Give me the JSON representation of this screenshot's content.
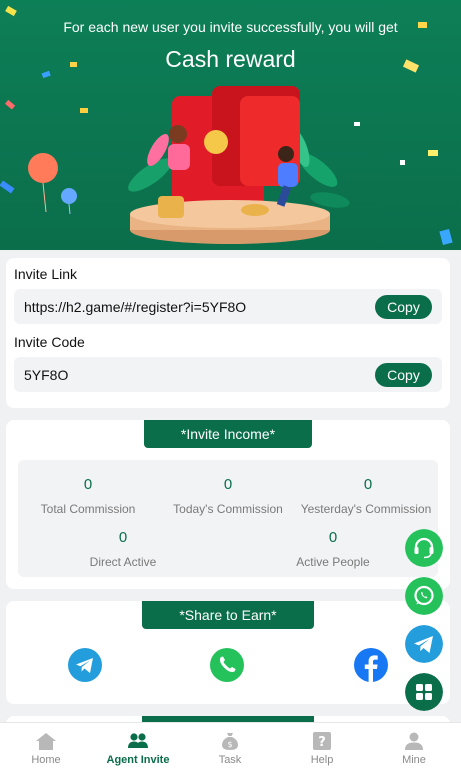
{
  "hero": {
    "subtitle": "For each new user you invite successfully, you will get",
    "title": "Cash reward"
  },
  "invite": {
    "link_label": "Invite Link",
    "link_value": "https://h2.game/#/register?i=5YF8O",
    "code_label": "Invite Code",
    "code_value": "5YF8O",
    "copy_label": "Copy"
  },
  "income": {
    "header": "*Invite Income*",
    "stats": [
      {
        "value": "0",
        "label": "Total Commission"
      },
      {
        "value": "0",
        "label": "Today's Commission"
      },
      {
        "value": "0",
        "label": "Yesterday's Commission"
      },
      {
        "value": "0",
        "label": "Direct Active"
      },
      {
        "value": "0",
        "label": "Active People"
      }
    ]
  },
  "share": {
    "header": "*Share to Earn*",
    "icons": [
      "telegram-icon",
      "phone-icon",
      "facebook-icon"
    ]
  },
  "floating": [
    "headset-icon",
    "whatsapp-icon",
    "telegram-icon",
    "grid-icon"
  ],
  "tabbar": {
    "items": [
      {
        "label": "Home",
        "icon": "home-icon"
      },
      {
        "label": "Agent Invite",
        "icon": "people-icon"
      },
      {
        "label": "Task",
        "icon": "money-bag-icon"
      },
      {
        "label": "Help",
        "icon": "help-icon"
      },
      {
        "label": "Mine",
        "icon": "user-icon"
      }
    ],
    "active_index": 1
  },
  "colors": {
    "brand": "#0b6e4b",
    "hero_bg": "#0d7f57",
    "whatsapp": "#25c25c",
    "telegram": "#239ddb",
    "facebook": "#1877f2"
  }
}
